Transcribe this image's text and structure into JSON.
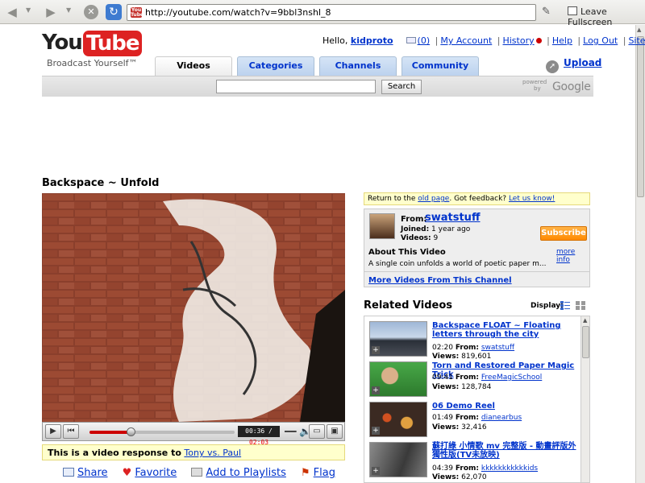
{
  "browser": {
    "url": "http://youtube.com/watch?v=9bbl3nshl_8",
    "leave_fullscreen": "Leave Fullscreen",
    "favicon_text": "You Tube"
  },
  "header": {
    "logo_you": "You",
    "logo_tube": "Tube",
    "tagline": "Broadcast Yourself™",
    "hello": "Hello,",
    "username": "kidproto",
    "inbox_count": "(0)",
    "my_account": "My Account",
    "history": "History",
    "help": "Help",
    "logout": "Log Out",
    "site": "Site:"
  },
  "tabs": [
    {
      "label": "Videos",
      "active": true
    },
    {
      "label": "Categories"
    },
    {
      "label": "Channels"
    },
    {
      "label": "Community"
    }
  ],
  "upload_label": "Upload",
  "search": {
    "button": "Search",
    "powered": "powered",
    "by": "by",
    "google": "Google"
  },
  "video": {
    "title": "Backspace ~ Unfold",
    "time_current": "00:36",
    "time_total": "02:03",
    "progress_fraction": 0.29,
    "response_prefix": "This is a video response to",
    "response_link": "Tony vs. Paul"
  },
  "actions": {
    "share": "Share",
    "favorite": "Favorite",
    "add_playlists": "Add to Playlists",
    "flag": "Flag"
  },
  "notice": {
    "return_prefix": "Return to the",
    "old_page": "old page",
    "feedback_prefix": ". Got feedback?",
    "let_us_know": "Let us know!"
  },
  "channel": {
    "from_label": "From:",
    "name": "swatstuff",
    "joined_label": "Joined:",
    "joined": "1 year ago",
    "videos_label": "Videos:",
    "videos": "9",
    "subscribe": "Subscribe",
    "about_label": "About This Video",
    "more_info": "more info",
    "about_text": "A single coin unfolds a world of poetic paper m...",
    "more_videos": "More Videos From This Channel"
  },
  "related": {
    "header": "Related Videos",
    "display_label": "Display:",
    "from_label": "From:",
    "views_label": "Views:",
    "items": [
      {
        "title": "Backspace FLOAT ~ Floating letters through the city",
        "duration": "02:20",
        "from": "swatstuff",
        "views": "819,601",
        "thumb_color": "#5a6e88"
      },
      {
        "title": "Torn and Restored Paper Magic Trick",
        "duration": "09:41",
        "from": "FreeMagicSchool",
        "views": "128,784",
        "thumb_color": "#3a9a3a"
      },
      {
        "title": "06 Demo Reel",
        "duration": "01:49",
        "from": "dianearbus",
        "views": "32,416",
        "thumb_color": "#3b2a22"
      },
      {
        "title": "蘇打綠 小情歌 mv 完整版 - 動畫評版外 獨性版(TV未放映)",
        "duration": "04:39",
        "from": "kkkkkkkkkkkids",
        "views": "62,070",
        "thumb_color": "#6a6a6a"
      }
    ]
  },
  "colors": {
    "link": "#0033cc",
    "youtube_red": "#dd2222",
    "subscribe_orange": "#ff8a00",
    "notice_yellow": "#ffffcc"
  }
}
